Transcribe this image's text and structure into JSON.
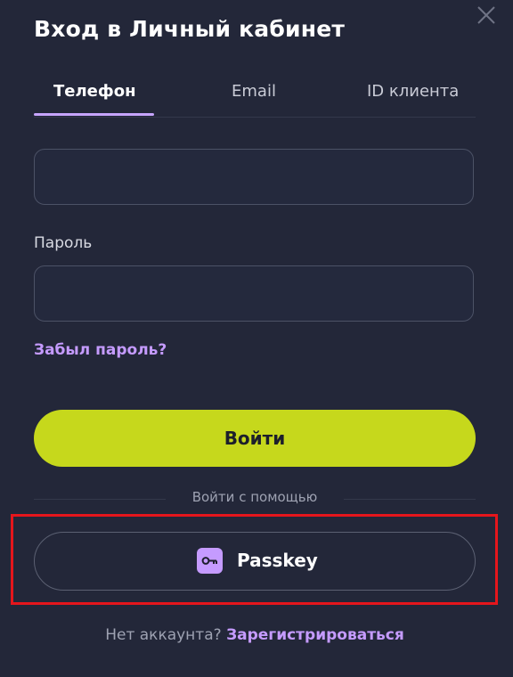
{
  "header": {
    "title": "Вход в Личный кабинет",
    "close_icon": "close-icon"
  },
  "tabs": [
    {
      "label": "Телефон",
      "active": true
    },
    {
      "label": "Email",
      "active": false
    },
    {
      "label": "ID клиента",
      "active": false
    }
  ],
  "form": {
    "phone_value": "",
    "password_label": "Пароль",
    "password_value": "",
    "forgot_link": "Забыл пароль?",
    "submit_label": "Войти"
  },
  "alt_login": {
    "divider_text": "Войти с помощью",
    "passkey_label": "Passkey",
    "passkey_icon": "key-icon"
  },
  "footer": {
    "no_account_text": "Нет аккаунта?",
    "register_link": "Зарегистрироваться"
  },
  "colors": {
    "background": "#232739",
    "accent_button": "#c6d81c",
    "link": "#c59bff",
    "highlight_box": "#e5161c"
  }
}
